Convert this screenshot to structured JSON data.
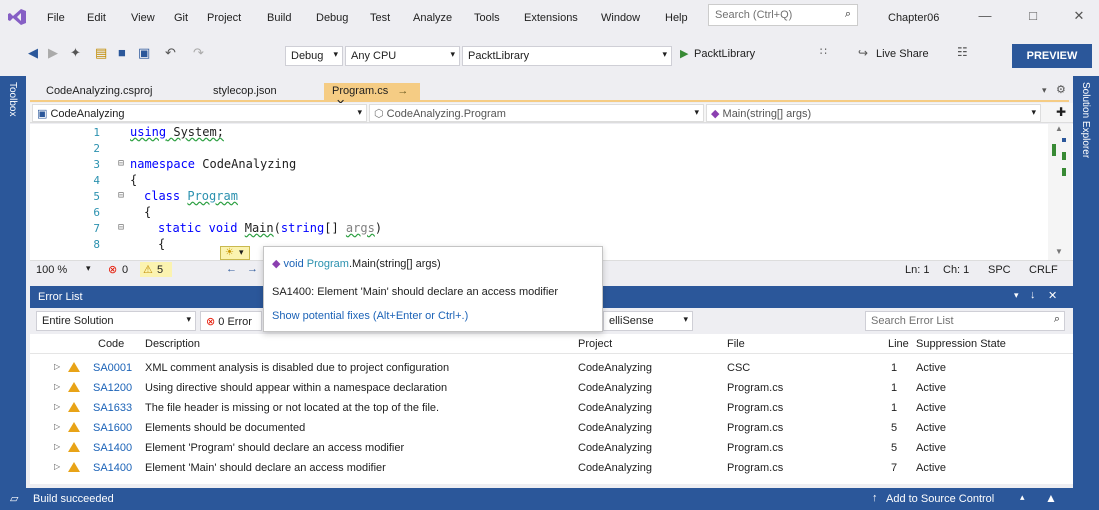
{
  "menu": [
    "File",
    "Edit",
    "View",
    "Git",
    "Project",
    "Build",
    "Debug",
    "Test",
    "Analyze",
    "Tools",
    "Extensions",
    "Window",
    "Help"
  ],
  "search": {
    "placeholder": "Search (Ctrl+Q)"
  },
  "solution_name": "Chapter06",
  "toolbar": {
    "config": "Debug",
    "platform": "Any CPU",
    "startup_project": "PacktLibrary",
    "run_target": "PacktLibrary",
    "live_share": "Live Share",
    "preview": "PREVIEW"
  },
  "side": {
    "left": "Toolbox",
    "right": "Solution Explorer"
  },
  "editor_tabs": [
    {
      "label": "CodeAnalyzing.csproj",
      "active": false
    },
    {
      "label": "stylecop.json",
      "active": false
    },
    {
      "label": "Program.cs",
      "active": true
    }
  ],
  "navbar": {
    "project": "CodeAnalyzing",
    "type": "CodeAnalyzing.Program",
    "member": "Main(string[] args)"
  },
  "code": {
    "line_numbers": [
      "1",
      "2",
      "3",
      "4",
      "5",
      "6",
      "7",
      "8"
    ],
    "using_kw": "using",
    "using_ns": " System;",
    "namespace_kw": "namespace",
    "namespace_name": " CodeAnalyzing",
    "brace": "{",
    "class_kw": "class",
    "class_name": "Program",
    "static_kw": "static",
    "void_kw": "void",
    "main_sig": "Main",
    "args_open": "(",
    "string_kw": "string",
    "args_rest": "[] ",
    "args_param": "args",
    "args_close": ")"
  },
  "editor_status": {
    "zoom": "100 %",
    "errors": "0",
    "warnings": "5",
    "ln": "Ln: 1",
    "ch": "Ch: 1",
    "spc": "SPC",
    "crlf": "CRLF"
  },
  "popup": {
    "signature": "void Program.Main(string[] args)",
    "sig_prefix": "void ",
    "sig_class": "Program",
    "sig_rest": ".Main(string[] args)",
    "message": "SA1400: Element 'Main' should declare an access modifier",
    "fix_link": "Show potential fixes",
    "fix_shortcut": " (Alt+Enter or Ctrl+.)"
  },
  "error_list": {
    "title": "Error List",
    "scope": "Entire Solution",
    "errors_filter": "0 Error",
    "intellisense": "elliSense",
    "search_placeholder": "Search Error List",
    "headers": {
      "code": "Code",
      "description": "Description",
      "project": "Project",
      "file": "File",
      "line": "Line",
      "suppression": "Suppression State"
    },
    "rows": [
      {
        "code": "SA0001",
        "description": "XML comment analysis is disabled due to project configuration",
        "project": "CodeAnalyzing",
        "file": "CSC",
        "line": "1",
        "state": "Active"
      },
      {
        "code": "SA1200",
        "description": "Using directive should appear within a namespace declaration",
        "project": "CodeAnalyzing",
        "file": "Program.cs",
        "line": "1",
        "state": "Active"
      },
      {
        "code": "SA1633",
        "description": "The file header is missing or not located at the top of the file.",
        "project": "CodeAnalyzing",
        "file": "Program.cs",
        "line": "1",
        "state": "Active"
      },
      {
        "code": "SA1600",
        "description": "Elements should be documented",
        "project": "CodeAnalyzing",
        "file": "Program.cs",
        "line": "5",
        "state": "Active"
      },
      {
        "code": "SA1400",
        "description": "Element 'Program' should declare an access modifier",
        "project": "CodeAnalyzing",
        "file": "Program.cs",
        "line": "5",
        "state": "Active"
      },
      {
        "code": "SA1400",
        "description": "Element 'Main' should declare an access modifier",
        "project": "CodeAnalyzing",
        "file": "Program.cs",
        "line": "7",
        "state": "Active"
      }
    ]
  },
  "statusbar": {
    "build": "Build succeeded",
    "source_control": "Add to Source Control"
  }
}
